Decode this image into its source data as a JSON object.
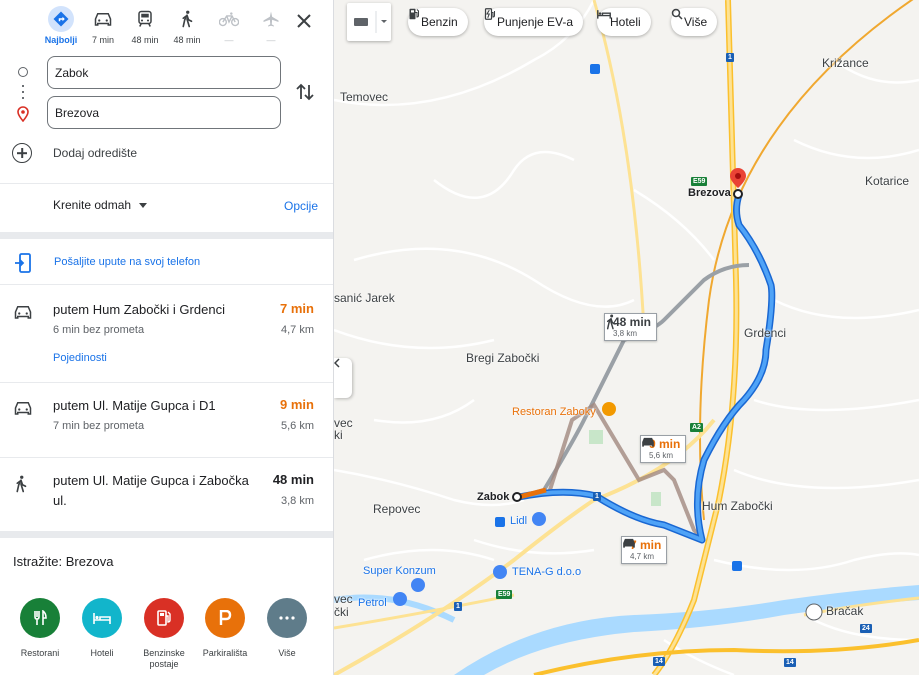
{
  "travel_modes": [
    {
      "name": "best",
      "label": "Najbolji",
      "active": true,
      "disabled": false
    },
    {
      "name": "car",
      "label": "7 min",
      "active": false,
      "disabled": false
    },
    {
      "name": "transit",
      "label": "48 min",
      "active": false,
      "disabled": false
    },
    {
      "name": "walk",
      "label": "48 min",
      "active": false,
      "disabled": false
    },
    {
      "name": "bike",
      "label": "—",
      "active": false,
      "disabled": true
    },
    {
      "name": "flight",
      "label": "—",
      "active": false,
      "disabled": true
    }
  ],
  "inputs": {
    "origin": "Zabok",
    "destination": "Brezova"
  },
  "add_destination": "Dodaj odredište",
  "leave_now": "Krenite odmah",
  "options": "Opcije",
  "send_to_phone": "Pošaljite upute na svoj telefon",
  "routes": [
    {
      "mode": "car",
      "title": "putem Hum Zabočki i Grdenci",
      "time": "7 min",
      "time_color": "#e8710a",
      "subtitle": "6 min bez prometa",
      "distance": "4,7 km",
      "details": "Pojedinosti"
    },
    {
      "mode": "car",
      "title": "putem Ul. Matije Gupca i D1",
      "time": "9 min",
      "time_color": "#e8710a",
      "subtitle": "7 min bez prometa",
      "distance": "5,6 km"
    },
    {
      "mode": "walk",
      "title": "putem Ul. Matije Gupca i Zabočka ul.",
      "time": "48 min",
      "time_color": "#202124",
      "subtitle": "",
      "distance": "3,8 km"
    }
  ],
  "explore": "Istražite: Brezova",
  "categories": [
    {
      "name": "restaurants",
      "label": "Restorani",
      "color": "#188038"
    },
    {
      "name": "hotels",
      "label": "Hoteli",
      "color": "#12b5cb"
    },
    {
      "name": "gas",
      "label": "Benzinske postaje",
      "color": "#d93025"
    },
    {
      "name": "parking",
      "label": "Parkirališta",
      "color": "#e8710a"
    },
    {
      "name": "more",
      "label": "Više",
      "color": "#5f6368"
    }
  ],
  "map": {
    "chips": [
      "Benzin",
      "Punjenje EV-a",
      "Hoteli",
      "Više"
    ],
    "places": {
      "temovec": "Temovec",
      "krizance": "Križance",
      "kotarice": "Kotarice",
      "brezova": "Brezova",
      "sanic_jarek": "sanić Jarek",
      "grdenci": "Grdenci",
      "bregi": "Bregi Zabočki",
      "restoran": "Restoran Zaboky",
      "vec_top": "vec",
      "ki_top": "ki",
      "zabok": "Zabok",
      "repovec": "Repovec",
      "lidl": "Lidl",
      "hum": "Hum Zabočki",
      "super_konzum": "Super Konzum",
      "tena": "TENA-G d.o.o",
      "vec_bottom": "vec",
      "cki_bottom": "čki",
      "petrol": "Petrol",
      "bracak": "Bračak"
    },
    "road_labels": {
      "e59_a": "E59",
      "e59_b": "E59",
      "a2": "A2",
      "r1": "1",
      "r1b": "1",
      "r1c": "1",
      "r1d": "1",
      "r14a": "14",
      "r14b": "14",
      "r24": "24"
    },
    "callouts": {
      "walk": {
        "time": "48 min",
        "dist": "3,8 km"
      },
      "alt": {
        "time": "9 min",
        "dist": "5,6 km"
      },
      "main": {
        "time": "7 min",
        "dist": "4,7 km"
      }
    }
  }
}
